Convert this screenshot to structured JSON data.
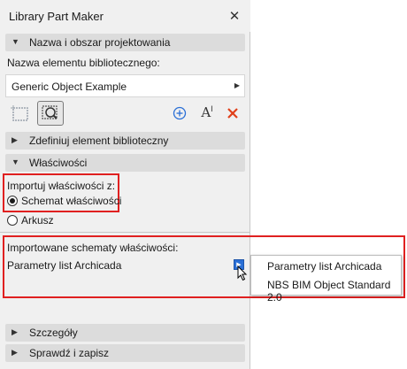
{
  "window": {
    "title": "Library Part Maker"
  },
  "sections": {
    "name_area": "Nazwa i obszar projektowania",
    "define": "Zdefiniuj element biblioteczny",
    "properties": "Właściwości",
    "details": "Szczegóły",
    "check_save": "Sprawdź i zapisz"
  },
  "name_field": {
    "label": "Nazwa elementu bibliotecznego:",
    "value": "Generic Object Example"
  },
  "import": {
    "label": "Importuj właściwości z:",
    "options": [
      "Schemat właściwości",
      "Arkusz"
    ],
    "selected": "Schemat właściwości"
  },
  "imported": {
    "label": "Importowane schematy właściwości:",
    "value": "Parametry list Archicada"
  },
  "dropdown_menu": {
    "items": [
      "Parametry list Archicada",
      "NBS BIM Object Standard 2.0"
    ]
  },
  "colors": {
    "highlight": "#e02020",
    "accent": "#2a6fd6",
    "section_bg": "#dcdcdc",
    "panel_bg": "#f0f0f0"
  }
}
